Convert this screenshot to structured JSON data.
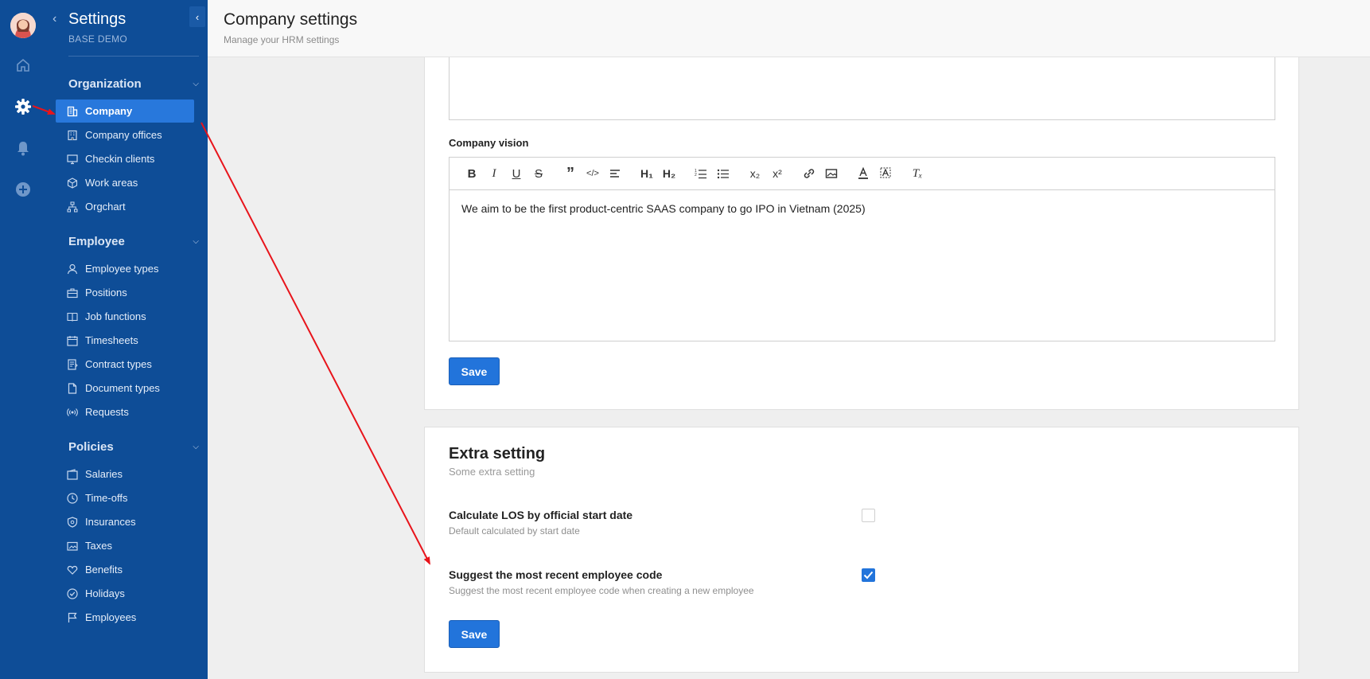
{
  "sidebar": {
    "title": "Settings",
    "subtitle": "BASE DEMO",
    "sections": [
      {
        "title": "Organization",
        "items": [
          {
            "label": "Company"
          },
          {
            "label": "Company offices"
          },
          {
            "label": "Checkin clients"
          },
          {
            "label": "Work areas"
          },
          {
            "label": "Orgchart"
          }
        ]
      },
      {
        "title": "Employee",
        "items": [
          {
            "label": "Employee types"
          },
          {
            "label": "Positions"
          },
          {
            "label": "Job functions"
          },
          {
            "label": "Timesheets"
          },
          {
            "label": "Contract types"
          },
          {
            "label": "Document types"
          },
          {
            "label": "Requests"
          }
        ]
      },
      {
        "title": "Policies",
        "items": [
          {
            "label": "Salaries"
          },
          {
            "label": "Time-offs"
          },
          {
            "label": "Insurances"
          },
          {
            "label": "Taxes"
          },
          {
            "label": "Benefits"
          },
          {
            "label": "Holidays"
          },
          {
            "label": "Employees"
          }
        ]
      }
    ],
    "active_item": "Company"
  },
  "header": {
    "title": "Company settings",
    "subtitle": "Manage your HRM settings"
  },
  "vision_card": {
    "label": "Company vision",
    "content": "We aim to be the first product-centric SAAS company to go IPO in Vietnam (2025)",
    "save_label": "Save"
  },
  "extra_card": {
    "title": "Extra setting",
    "subtitle": "Some extra setting",
    "options": [
      {
        "label": "Calculate LOS by official start date",
        "description": "Default calculated by start date",
        "checked": false
      },
      {
        "label": "Suggest the most recent employee code",
        "description": "Suggest the most recent employee code when creating a new employee",
        "checked": true
      }
    ],
    "save_label": "Save"
  },
  "colors": {
    "sidebar_bg": "#0e4d97",
    "active_item_bg": "#2878dc",
    "primary_button": "#2274db",
    "annotation_arrow": "#e8141b"
  }
}
